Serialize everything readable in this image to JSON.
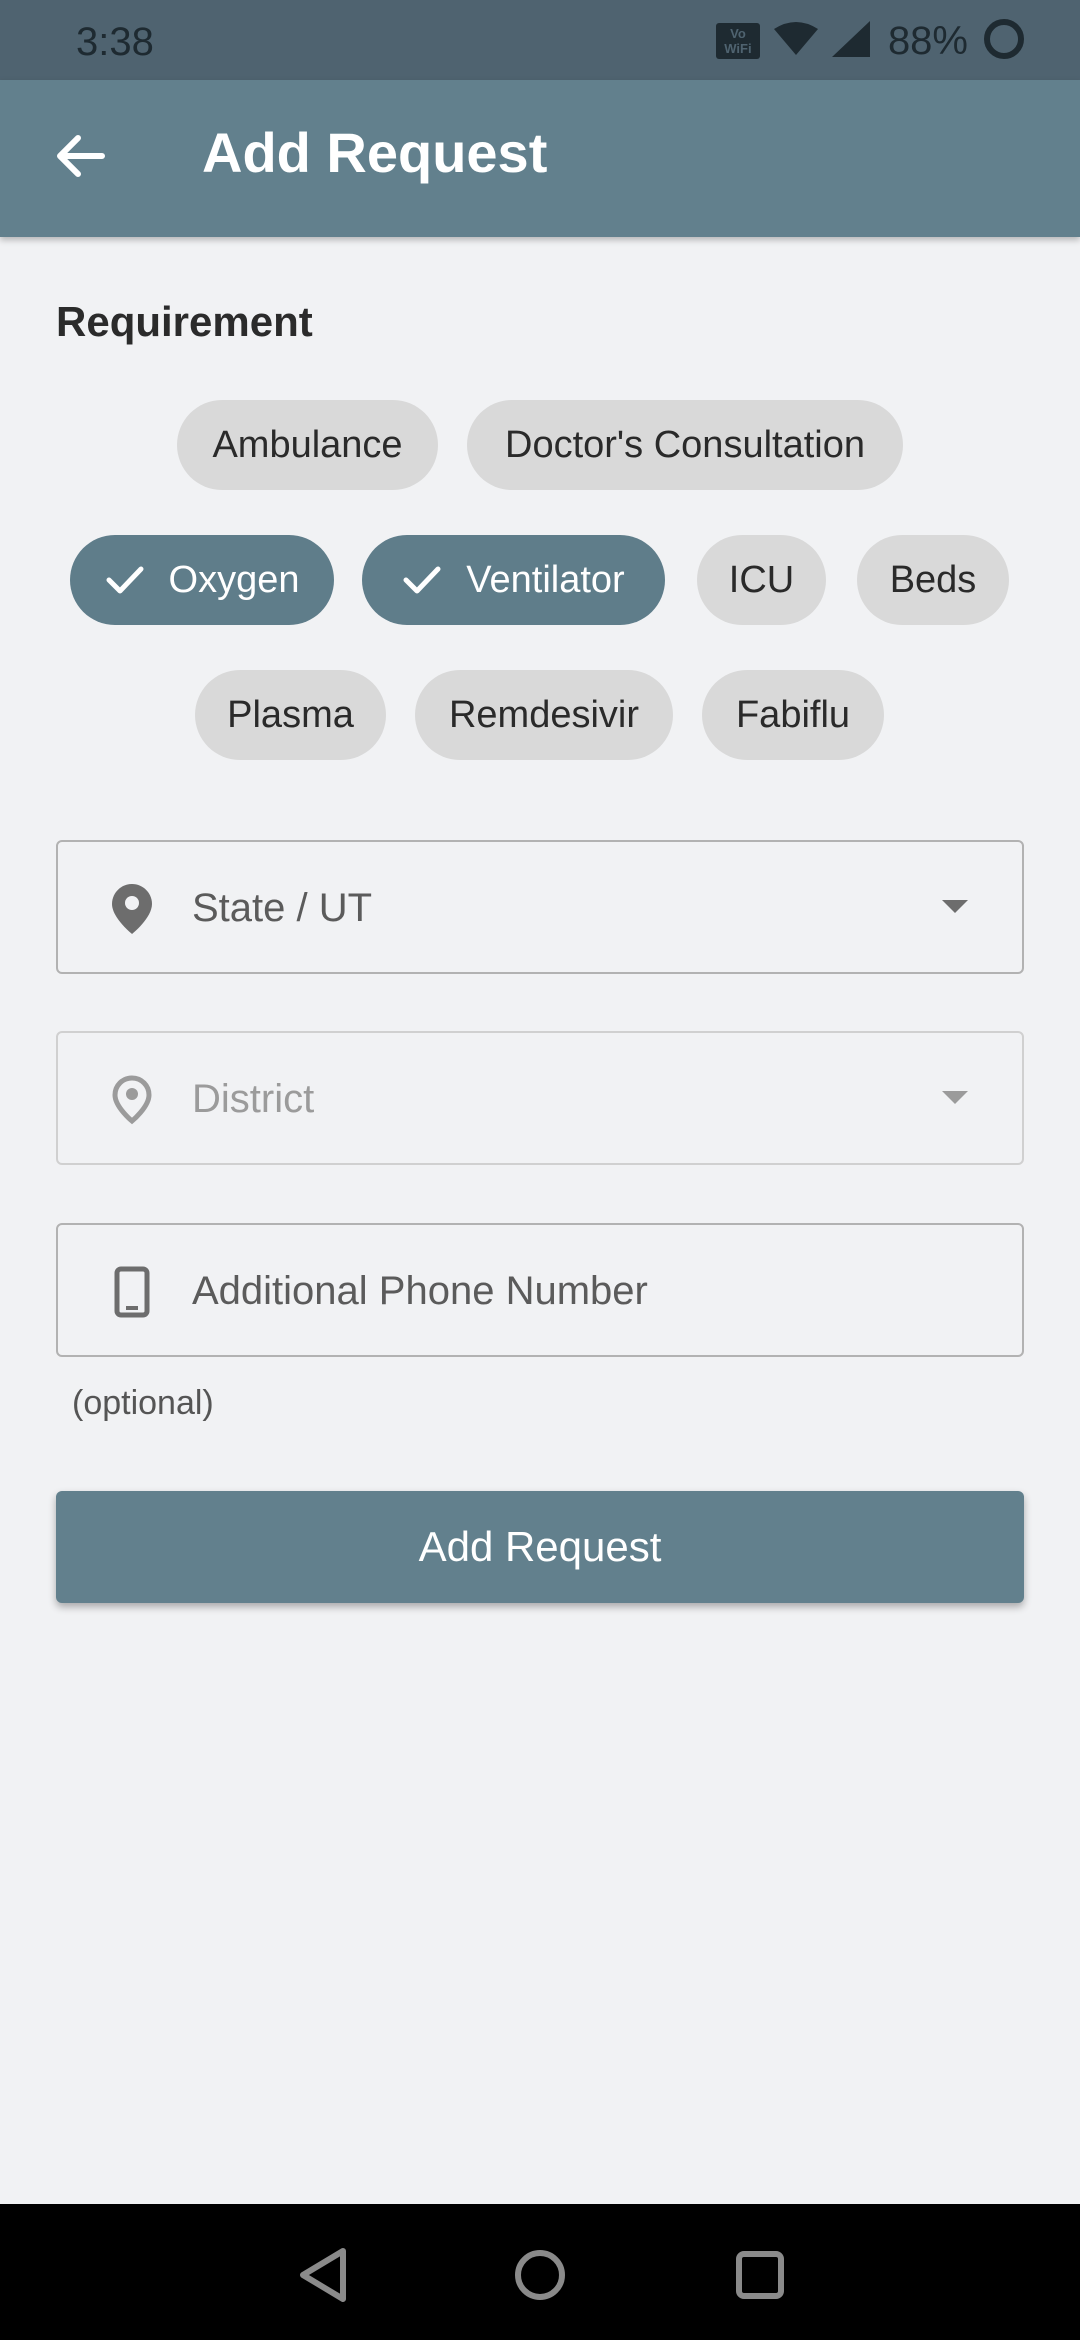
{
  "status": {
    "time": "3:38",
    "vowifi_line1": "Vo",
    "vowifi_line2": "WiFi",
    "battery": "88%"
  },
  "appbar": {
    "title": "Add Request",
    "back_icon": "arrow-back-icon"
  },
  "requirement": {
    "label": "Requirement",
    "chips": [
      {
        "label": "Ambulance",
        "selected": false
      },
      {
        "label": "Doctor's Consultation",
        "selected": false
      },
      {
        "label": "Oxygen",
        "selected": true
      },
      {
        "label": "Ventilator",
        "selected": true
      },
      {
        "label": "ICU",
        "selected": false
      },
      {
        "label": "Beds",
        "selected": false
      },
      {
        "label": "Plasma",
        "selected": false
      },
      {
        "label": "Remdesivir",
        "selected": false
      },
      {
        "label": "Fabiflu",
        "selected": false
      }
    ]
  },
  "form": {
    "state": {
      "text": "State / UT",
      "icon": "location-pin-icon"
    },
    "district": {
      "text": "District",
      "icon": "location-pin-outline-icon"
    },
    "phone": {
      "placeholder": "Additional Phone Number",
      "icon": "phone-icon",
      "helper": "(optional)"
    },
    "submit_label": "Add Request"
  },
  "colors": {
    "primary": "#62808d",
    "status_bar": "#4f6370",
    "background": "#f1f2f4",
    "chip": "#d9d9d9"
  }
}
